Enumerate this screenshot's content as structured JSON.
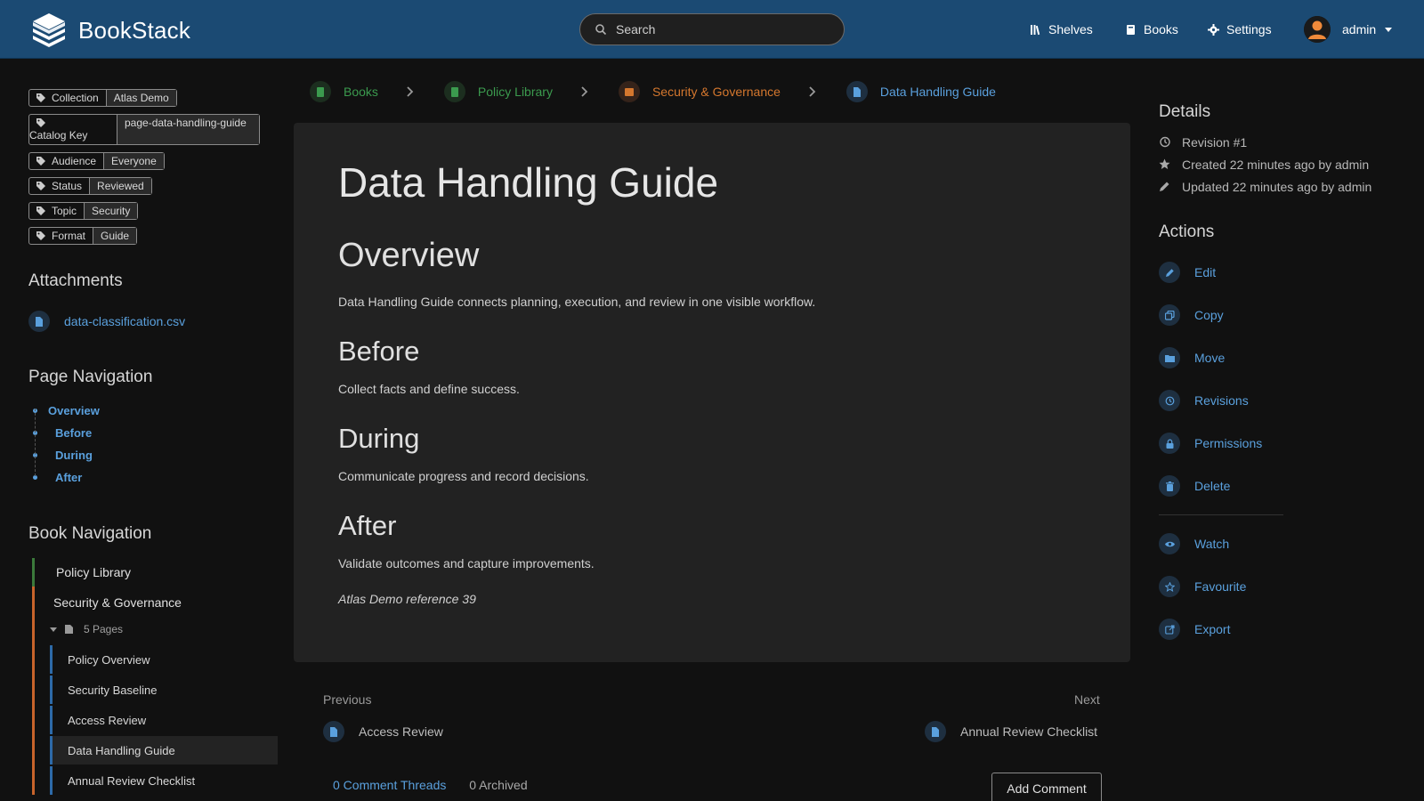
{
  "app": {
    "brand": "BookStack",
    "search_placeholder": "Search",
    "nav": {
      "shelves": "Shelves",
      "books": "Books",
      "settings": "Settings"
    },
    "user": "admin"
  },
  "tags": [
    {
      "key": "Collection",
      "value": "Atlas Demo"
    },
    {
      "key": "Catalog Key",
      "value": "page-data-handling-guide"
    },
    {
      "key": "Audience",
      "value": "Everyone"
    },
    {
      "key": "Status",
      "value": "Reviewed"
    },
    {
      "key": "Topic",
      "value": "Security"
    },
    {
      "key": "Format",
      "value": "Guide"
    }
  ],
  "attachments": {
    "heading": "Attachments",
    "file": "data-classification.csv"
  },
  "page_nav": {
    "heading": "Page Navigation",
    "items": [
      "Overview",
      "Before",
      "During",
      "After"
    ]
  },
  "book_nav": {
    "heading": "Book Navigation",
    "book": "Policy Library",
    "chapter": "Security & Governance",
    "pages_toggle": "5 Pages",
    "pages": [
      "Policy Overview",
      "Security Baseline",
      "Access Review",
      "Data Handling Guide",
      "Annual Review Checklist"
    ]
  },
  "breadcrumb": [
    "Books",
    "Policy Library",
    "Security & Governance",
    "Data Handling Guide"
  ],
  "colors": {
    "header": "#1b4a73",
    "link": "#5aa0dd",
    "book": "#3b9a4e",
    "chapter": "#d4772e"
  },
  "page": {
    "title": "Data Handling Guide",
    "overview_h": "Overview",
    "overview_p": "Data Handling Guide connects planning, execution, and review in one visible workflow.",
    "before_h": "Before",
    "before_p": "Collect facts and define success.",
    "during_h": "During",
    "during_p": "Communicate progress and record decisions.",
    "after_h": "After",
    "after_p": "Validate outcomes and capture improvements.",
    "reference": "Atlas Demo reference 39"
  },
  "prevnext": {
    "prev_label": "Previous",
    "prev": "Access Review",
    "next_label": "Next",
    "next": "Annual Review Checklist"
  },
  "comments": {
    "threads": "0 Comment Threads",
    "archived": "0 Archived",
    "add": "Add Comment"
  },
  "details": {
    "heading": "Details",
    "revision": "Revision #1",
    "created": "Created 22 minutes ago by admin",
    "updated": "Updated 22 minutes ago by admin"
  },
  "actions": {
    "heading": "Actions",
    "items": [
      "Edit",
      "Copy",
      "Move",
      "Revisions",
      "Permissions",
      "Delete"
    ],
    "extra": [
      "Watch",
      "Favourite",
      "Export"
    ]
  }
}
